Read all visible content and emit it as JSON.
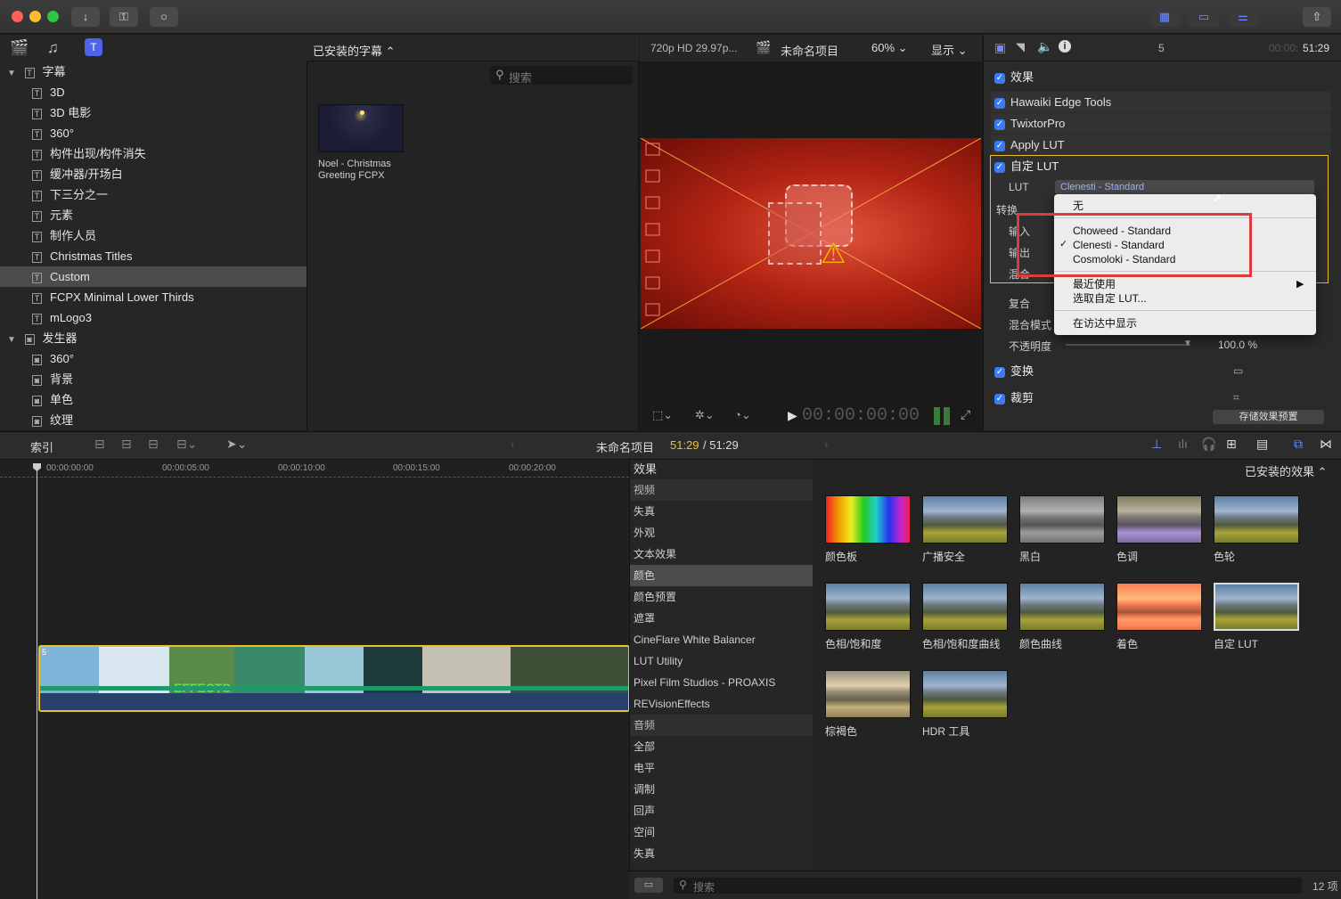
{
  "toolbar": {
    "download_icon": "↓",
    "key_icon": "⚿",
    "circle_icon": "○",
    "view1": "▦",
    "view2": "▭",
    "view3": "⚌",
    "share": "⇧"
  },
  "library_bar": {
    "title": "已安装的字幕 ⌃",
    "search_placeholder": "搜索"
  },
  "sidebar": {
    "items": [
      {
        "label": "字幕",
        "type": "group"
      },
      {
        "label": "3D"
      },
      {
        "label": "3D 电影"
      },
      {
        "label": "360°"
      },
      {
        "label": "构件出现/构件消失"
      },
      {
        "label": "缓冲器/开场白"
      },
      {
        "label": "下三分之一"
      },
      {
        "label": "元素"
      },
      {
        "label": "制作人员"
      },
      {
        "label": "Christmas Titles"
      },
      {
        "label": "Custom",
        "selected": true
      },
      {
        "label": "FCPX Minimal Lower Thirds"
      },
      {
        "label": "mLogo3"
      },
      {
        "label": "发生器",
        "type": "group"
      },
      {
        "label": "360°"
      },
      {
        "label": "背景"
      },
      {
        "label": "单色"
      },
      {
        "label": "纹理"
      }
    ]
  },
  "browser": {
    "clip_title": "Noel - Christmas Greeting FCPX"
  },
  "viewer": {
    "format": "720p HD 29.97p...",
    "project": "未命名项目",
    "zoom": "60% ⌄",
    "display": "显示 ⌄",
    "timecode": "00:00:00:00"
  },
  "inspector": {
    "clip_number": "5",
    "duration_dim": "00:00:",
    "duration": "51:29",
    "effects_label": "效果",
    "effects": [
      "Hawaiki Edge Tools",
      "TwixtorPro",
      "Apply LUT",
      "自定 LUT"
    ],
    "lut_label": "LUT",
    "lut_value": "Clenesti - Standard",
    "transform_label": "转换",
    "input_label": "输入",
    "output_label": "输出",
    "mix_label": "混合",
    "composite_label": "复合",
    "blend_label": "混合模式",
    "opacity_label": "不透明度",
    "opacity_value": "100.0 %",
    "transform_section": "变换",
    "crop_section": "裁剪",
    "save_preset": "存储效果预置"
  },
  "lut_menu": {
    "none": "无",
    "options": [
      "Choweed - Standard",
      "Clenesti - Standard",
      "Cosmoloki - Standard"
    ],
    "checked": "✓",
    "recent": "最近使用",
    "choose": "选取自定 LUT...",
    "reveal": "在访达中显示",
    "arrow": "▶"
  },
  "timeline_bar": {
    "index": "索引",
    "project": "未命名项目",
    "position": "51:29",
    "total": "/ 51:29"
  },
  "ruler": [
    "00:00:00:00",
    "00:00:05:00",
    "00:00:10:00",
    "00:00:15:00",
    "00:00:20:00"
  ],
  "clip": {
    "number": "5",
    "text": "EFFECTS"
  },
  "effects_browser": {
    "header": "效果",
    "installed": "已安装的效果 ⌃",
    "categories": [
      {
        "label": "视频",
        "head": true
      },
      {
        "label": "失真"
      },
      {
        "label": "外观"
      },
      {
        "label": "文本效果"
      },
      {
        "label": "颜色",
        "selected": true
      },
      {
        "label": "颜色预置"
      },
      {
        "label": "遮罩"
      },
      {
        "label": "CineFlare White Balancer"
      },
      {
        "label": "LUT Utility"
      },
      {
        "label": "Pixel Film Studios - PROAXIS"
      },
      {
        "label": "REVisionEffects"
      },
      {
        "label": "音频",
        "head": true
      },
      {
        "label": "全部"
      },
      {
        "label": "电平"
      },
      {
        "label": "调制"
      },
      {
        "label": "回声"
      },
      {
        "label": "空间"
      },
      {
        "label": "失真"
      }
    ],
    "thumbs": [
      "颜色板",
      "广播安全",
      "黑白",
      "色调",
      "色轮",
      "色相/饱和度",
      "色相/饱和度曲线",
      "颜色曲线",
      "着色",
      "自定 LUT",
      "棕褐色",
      "HDR 工具"
    ],
    "search_placeholder": "搜索",
    "count": "12 项"
  },
  "colors": {
    "accent": "#3d7bf6",
    "highlight": "#e8c22e",
    "menu_outline": "#e0393e"
  }
}
